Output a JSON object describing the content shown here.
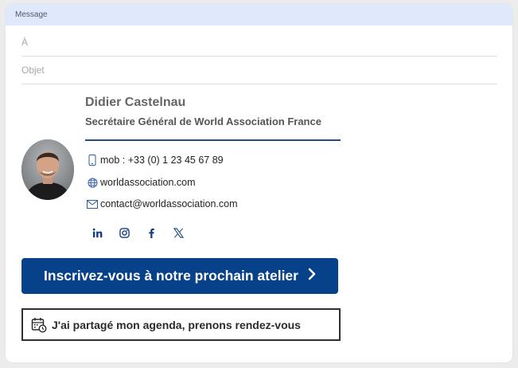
{
  "header": {
    "title": "Message"
  },
  "fields": {
    "to_label": "À",
    "subject_label": "Objet"
  },
  "signature": {
    "name": "Didier Castelnau",
    "title": "Secrétaire Général de World Association France",
    "phone": "mob : +33 (0) 1 23 45 67 89",
    "website": "worldassociation.com",
    "email": "contact@worldassociation.com",
    "accent_color": "#06418a",
    "socials": [
      "linkedin-icon",
      "instagram-icon",
      "facebook-icon",
      "x-icon"
    ]
  },
  "cta": {
    "label": "Inscrivez-vous à notre prochain atelier",
    "color": "#06418a"
  },
  "agenda": {
    "label": "J'ai partagé mon agenda, prenons rendez-vous"
  }
}
